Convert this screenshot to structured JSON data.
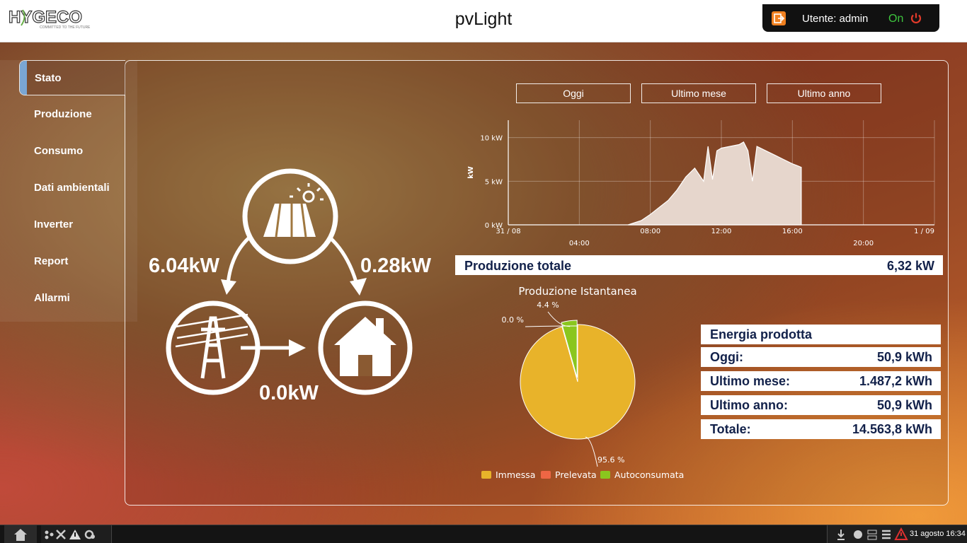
{
  "header": {
    "title": "pvLight",
    "logo_text": "HYGECO",
    "logo_tagline": "COMMITTED TO THE FUTURE",
    "user_label": "Utente: admin",
    "status": "On",
    "icons": [
      "logout-icon",
      "power-icon"
    ]
  },
  "sidebar": {
    "items": [
      {
        "label": "Stato",
        "active": true
      },
      {
        "label": "Produzione"
      },
      {
        "label": "Consumo"
      },
      {
        "label": "Dati ambientali"
      },
      {
        "label": "Inverter"
      },
      {
        "label": "Report"
      },
      {
        "label": "Allarmi"
      }
    ]
  },
  "period_buttons": [
    "Oggi",
    "Ultimo mese",
    "Ultimo anno"
  ],
  "flow": {
    "solar_to_grid": "6.04kW",
    "solar_to_home": "0.28kW",
    "grid_to_home": "0.0kW",
    "icons": [
      "solar-panel-icon",
      "power-tower-icon",
      "house-icon"
    ]
  },
  "chart_data": [
    {
      "type": "area",
      "ylabel": "kW",
      "yticks": [
        "0 kW",
        "5 kW",
        "10 kW"
      ],
      "ylim": [
        0,
        12
      ],
      "xticks_top": [
        "31 / 08",
        "08:00",
        "12:00",
        "16:00",
        "1 / 09"
      ],
      "xticks_bottom": [
        "04:00",
        "20:00"
      ],
      "grid": true,
      "x": [
        "06:45",
        "07:30",
        "08:00",
        "08:30",
        "09:00",
        "09:30",
        "10:00",
        "10:30",
        "11:00",
        "11:15",
        "11:30",
        "11:45",
        "12:00",
        "12:30",
        "13:00",
        "13:15",
        "13:30",
        "13:45",
        "14:00",
        "14:30",
        "15:00",
        "15:30",
        "16:00",
        "16:15",
        "16:30"
      ],
      "values": [
        0,
        0.5,
        1.2,
        2.0,
        2.8,
        4.0,
        5.5,
        6.5,
        5.0,
        9.0,
        5.2,
        8.5,
        8.8,
        9.0,
        9.2,
        9.5,
        8.5,
        5.0,
        9.0,
        8.5,
        8.0,
        7.5,
        7.0,
        6.8,
        6.6
      ],
      "color": "#e6d6cc"
    },
    {
      "type": "pie",
      "title": "Produzione Istantanea",
      "labels": [
        "Immessa",
        "Prelevata",
        "Autoconsumata"
      ],
      "values": [
        95.6,
        0.0,
        4.4
      ],
      "value_labels": [
        "95.6 %",
        "0.0 %",
        "4.4 %"
      ],
      "colors": [
        "#e8b32a",
        "#ee6644",
        "#8ac61e"
      ],
      "legend": "bottom"
    }
  ],
  "production": {
    "total_label": "Produzione totale",
    "total_value": "6,32 kW"
  },
  "energy": {
    "title": "Energia prodotta",
    "rows": [
      {
        "label": "Oggi:",
        "value": "50,9 kWh"
      },
      {
        "label": "Ultimo mese:",
        "value": "1.487,2 kWh"
      },
      {
        "label": "Ultimo anno:",
        "value": "50,9 kWh"
      },
      {
        "label": "Totale:",
        "value": "14.563,8 kWh"
      }
    ]
  },
  "taskbar": {
    "clock": "31 agosto 16:34",
    "icons": [
      "home-icon",
      "network-icon",
      "tools-icon",
      "warning-icon",
      "settings-icon",
      "download-icon",
      "globe-icon",
      "network-tray-icon",
      "list-icon",
      "alert-icon"
    ]
  }
}
